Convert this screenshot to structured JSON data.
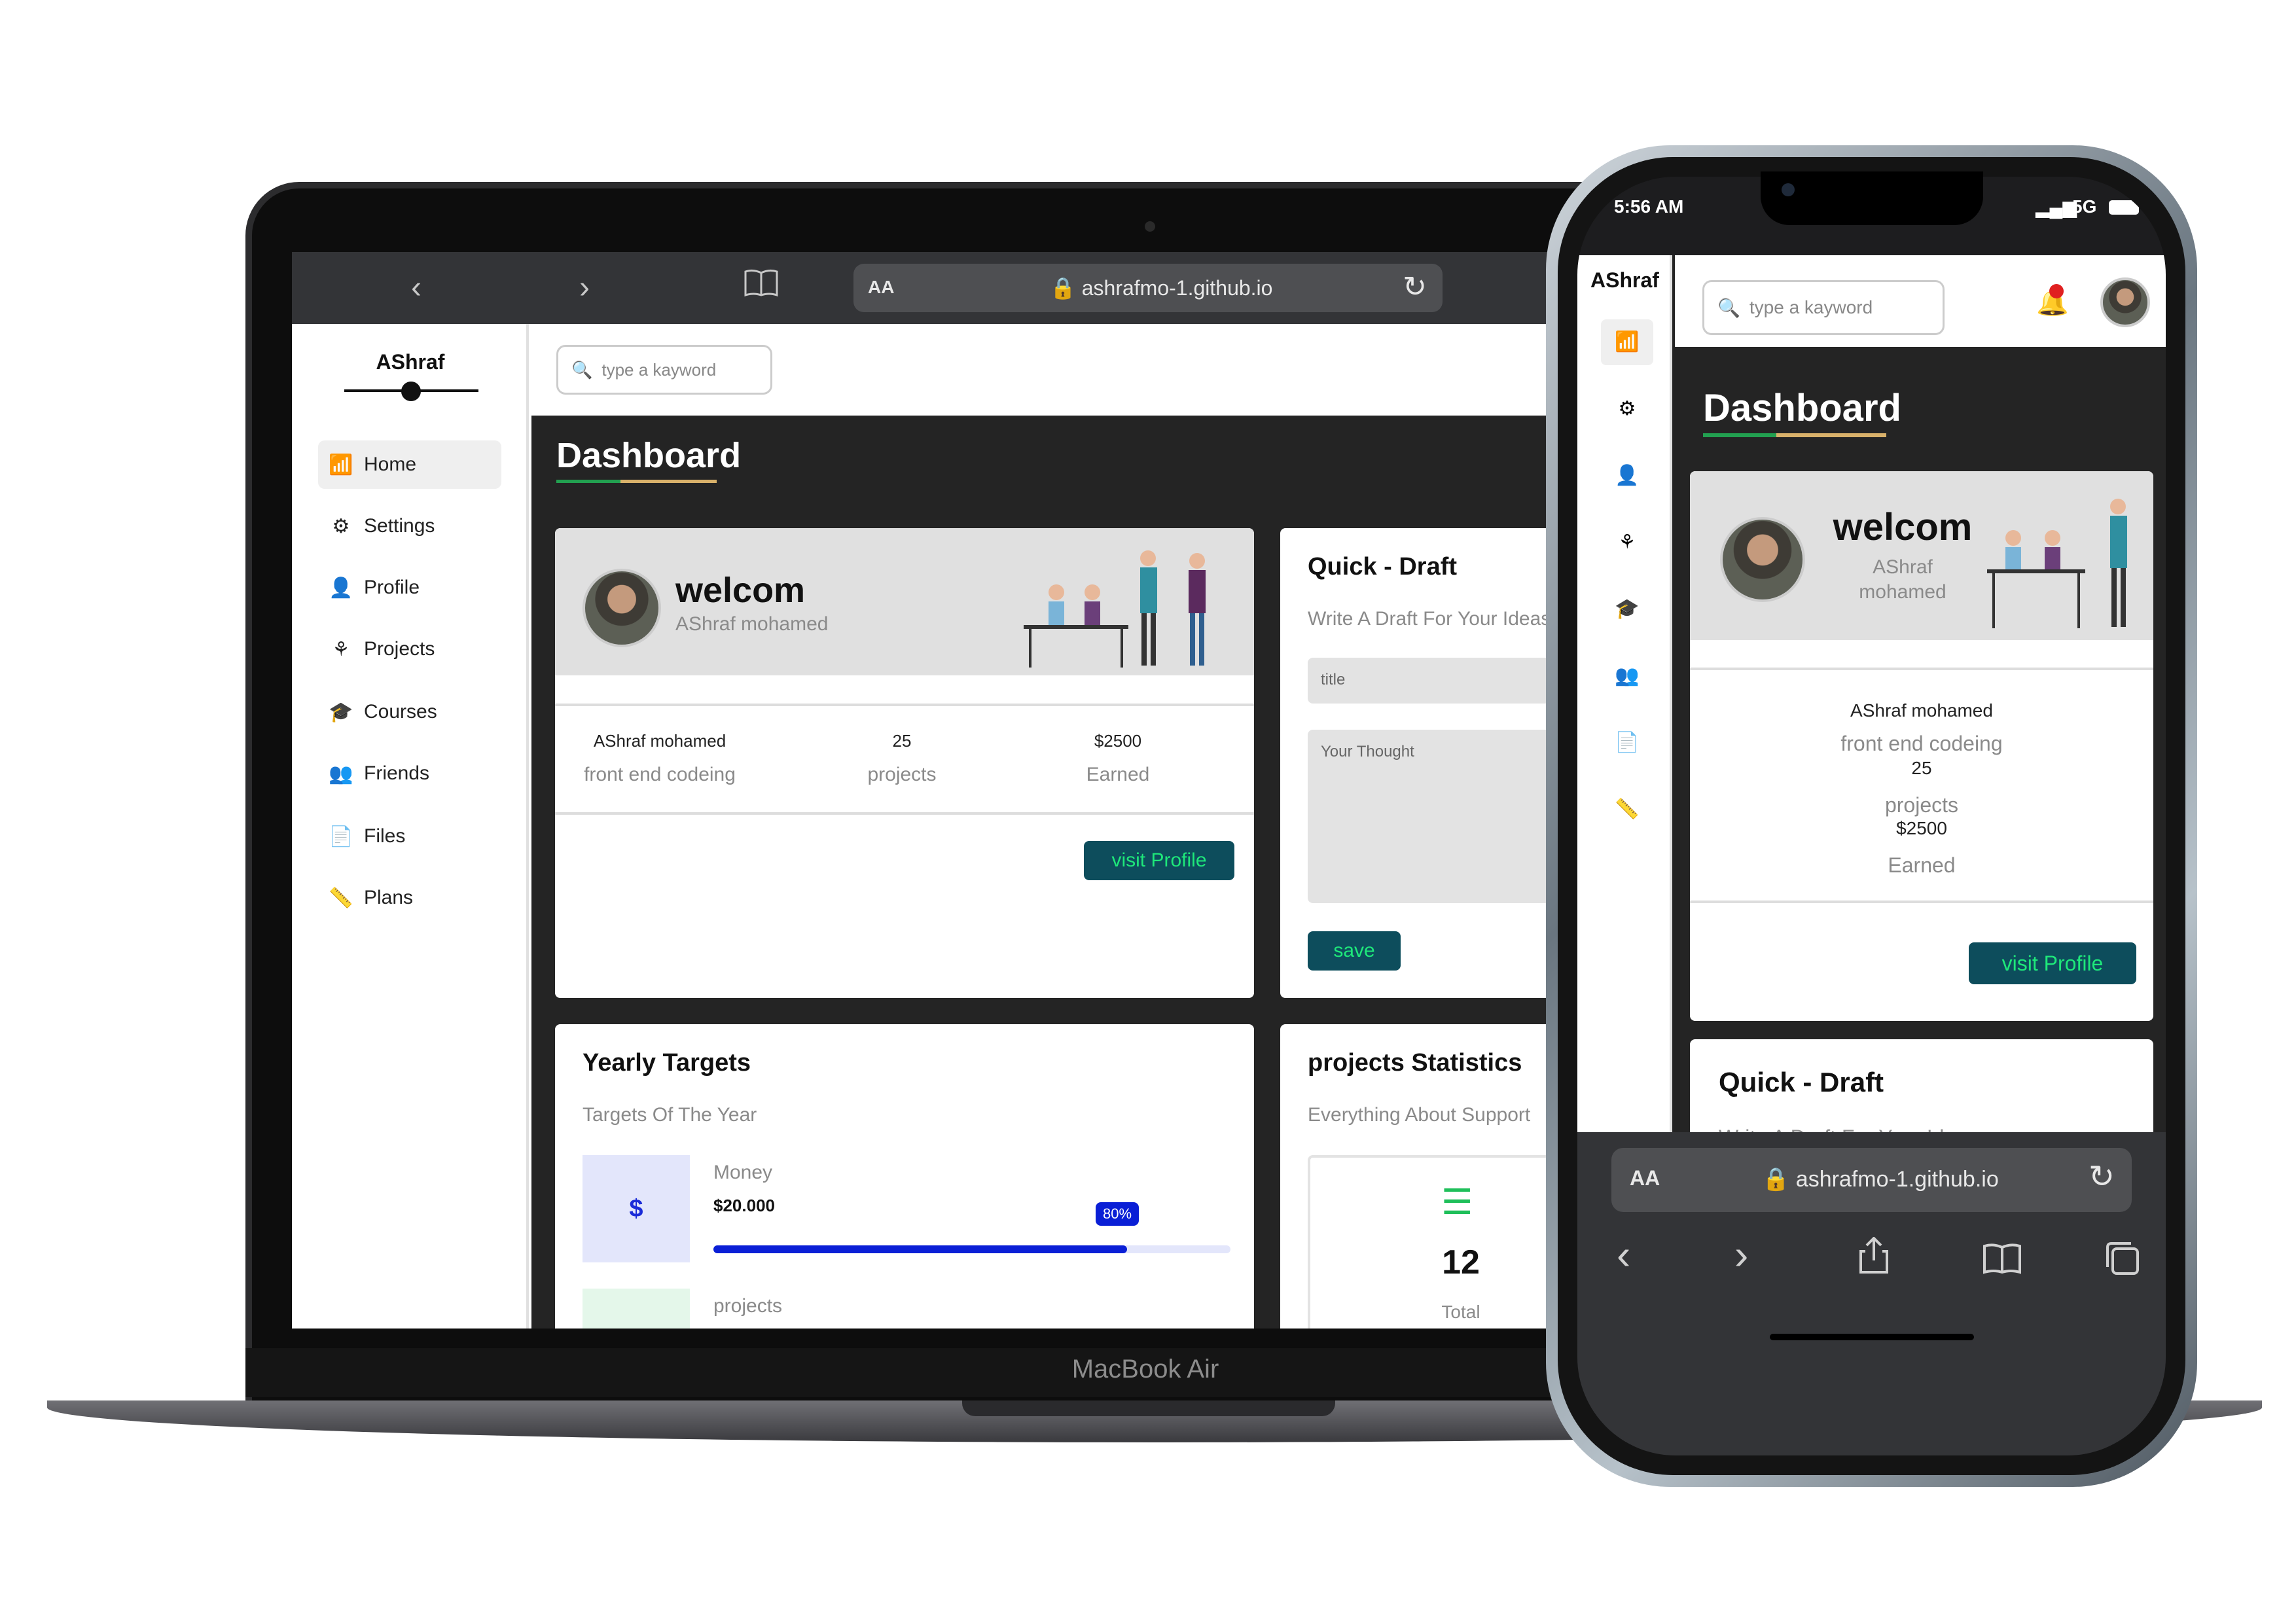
{
  "laptop": {
    "brand_label": "MacBook Air",
    "browser": {
      "back_icon": "chevron-left-icon",
      "forward_icon": "chevron-right-icon",
      "bookmarks_icon": "book-icon",
      "text_size": "AA",
      "url": "ashrafmo-1.github.io",
      "reload_icon": "reload-icon",
      "share_icon": "share-icon"
    },
    "sidebar": {
      "brand": "AShraf",
      "items": [
        {
          "label": "Home",
          "icon": "chart-icon",
          "active": true
        },
        {
          "label": "Settings",
          "icon": "gear-icon"
        },
        {
          "label": "Profile",
          "icon": "user-icon"
        },
        {
          "label": "Projects",
          "icon": "diagram-icon"
        },
        {
          "label": "Courses",
          "icon": "graduation-cap-icon"
        },
        {
          "label": "Friends",
          "icon": "users-icon"
        },
        {
          "label": "Files",
          "icon": "file-icon"
        },
        {
          "label": "Plans",
          "icon": "ruler-icon"
        }
      ]
    },
    "search": {
      "placeholder": "type a kayword"
    },
    "dashboard_title": "Dashboard",
    "welcome": {
      "heading": "welcom",
      "name": "AShraf mohamed",
      "stats": [
        {
          "value": "AShraf mohamed",
          "label": "front end codeing"
        },
        {
          "value": "25",
          "label": "projects"
        },
        {
          "value": "$2500",
          "label": "Earned"
        }
      ],
      "button": "visit Profile"
    },
    "quick_draft": {
      "title": "Quick - Draft",
      "subtitle": "Write A Draft For Your Ideas",
      "title_placeholder": "title",
      "thought_placeholder": "Your Thought",
      "save": "save"
    },
    "yearly_targets": {
      "title": "Yearly Targets",
      "subtitle": "Targets Of The Year",
      "money": {
        "label": "Money",
        "value": "$20.000",
        "progress": 80,
        "progress_label": "80%",
        "icon_char": "$"
      },
      "projects_label": "projects"
    },
    "projects_statistics": {
      "title": "projects Statistics",
      "subtitle": "Everything About Support",
      "count": "12",
      "count_label": "Total"
    }
  },
  "phone": {
    "status": {
      "time": "5:56 AM",
      "network": "5G"
    },
    "brand": "AShraf",
    "search": {
      "placeholder": "type a kayword"
    },
    "dashboard_title": "Dashboard",
    "welcome": {
      "heading": "welcom",
      "name_line1": "AShraf",
      "name_line2": "mohamed",
      "stats": [
        "AShraf mohamed",
        "front end codeing",
        "25",
        "projects",
        "$2500",
        "Earned"
      ],
      "button": "visit Profile"
    },
    "quick_draft": {
      "title": "Quick - Draft",
      "subtitle": "Write A Draft For Your Ideas",
      "title_placeholder": "title"
    },
    "browser": {
      "text_size": "AA",
      "url": "ashrafmo-1.github.io"
    }
  },
  "colors": {
    "accent_teal": "#0d4d5c",
    "button_text": "#1ee87a",
    "progress_blue": "#0a1fd6",
    "dark_bg": "#242424"
  }
}
